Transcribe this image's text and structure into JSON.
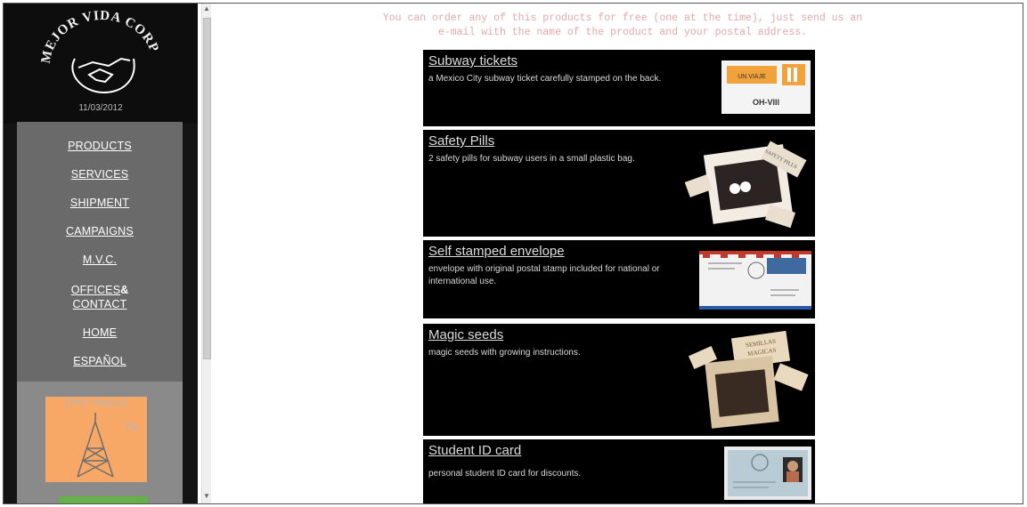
{
  "logo": {
    "name": "MEJOR VIDA CORP",
    "date": "11/03/2012"
  },
  "nav": {
    "items": [
      {
        "label": "PRODUCTS"
      },
      {
        "label": "SERVICES"
      },
      {
        "label": "SHIPMENT"
      },
      {
        "label": "CAMPAIGNS"
      },
      {
        "label": "M.V.C."
      },
      {
        "label": "OFFICES"
      },
      {
        "label": "CONTACT"
      },
      {
        "label": "HOME"
      },
      {
        "label": "ESPAÑOL"
      }
    ],
    "ampersand": "&"
  },
  "radio": {
    "label": "[MVC:Radio]",
    "suffix": "fm"
  },
  "intro": {
    "line1": "You can order any of this products for free (one at the time), just send us an",
    "line2": "e-mail with the name of the product and your postal address."
  },
  "products": [
    {
      "title": "Subway tickets",
      "desc": "a Mexico City subway ticket carefully stamped on the back."
    },
    {
      "title": "Safety Pills",
      "desc": "2 safety pills for subway users in a small plastic bag."
    },
    {
      "title": "Self stamped envelope",
      "desc": "envelope with original postal stamp included for national or international use."
    },
    {
      "title": "Magic seeds",
      "desc": "magic seeds with growing instructions."
    },
    {
      "title": "Student ID card",
      "desc": "personal student ID card for discounts."
    }
  ],
  "thumb_text": {
    "ticket_a": "UN VIAJE",
    "ticket_b": "OH-VIII",
    "pills": "SAFETY PILLS",
    "seeds": "SEMILLAS MAGICAS"
  },
  "colors": {
    "sidebar": "#141414",
    "nav": "#6a6a6a",
    "radio": "#f7a866",
    "intro_text": "#e4aaaa",
    "card": "#000000"
  }
}
